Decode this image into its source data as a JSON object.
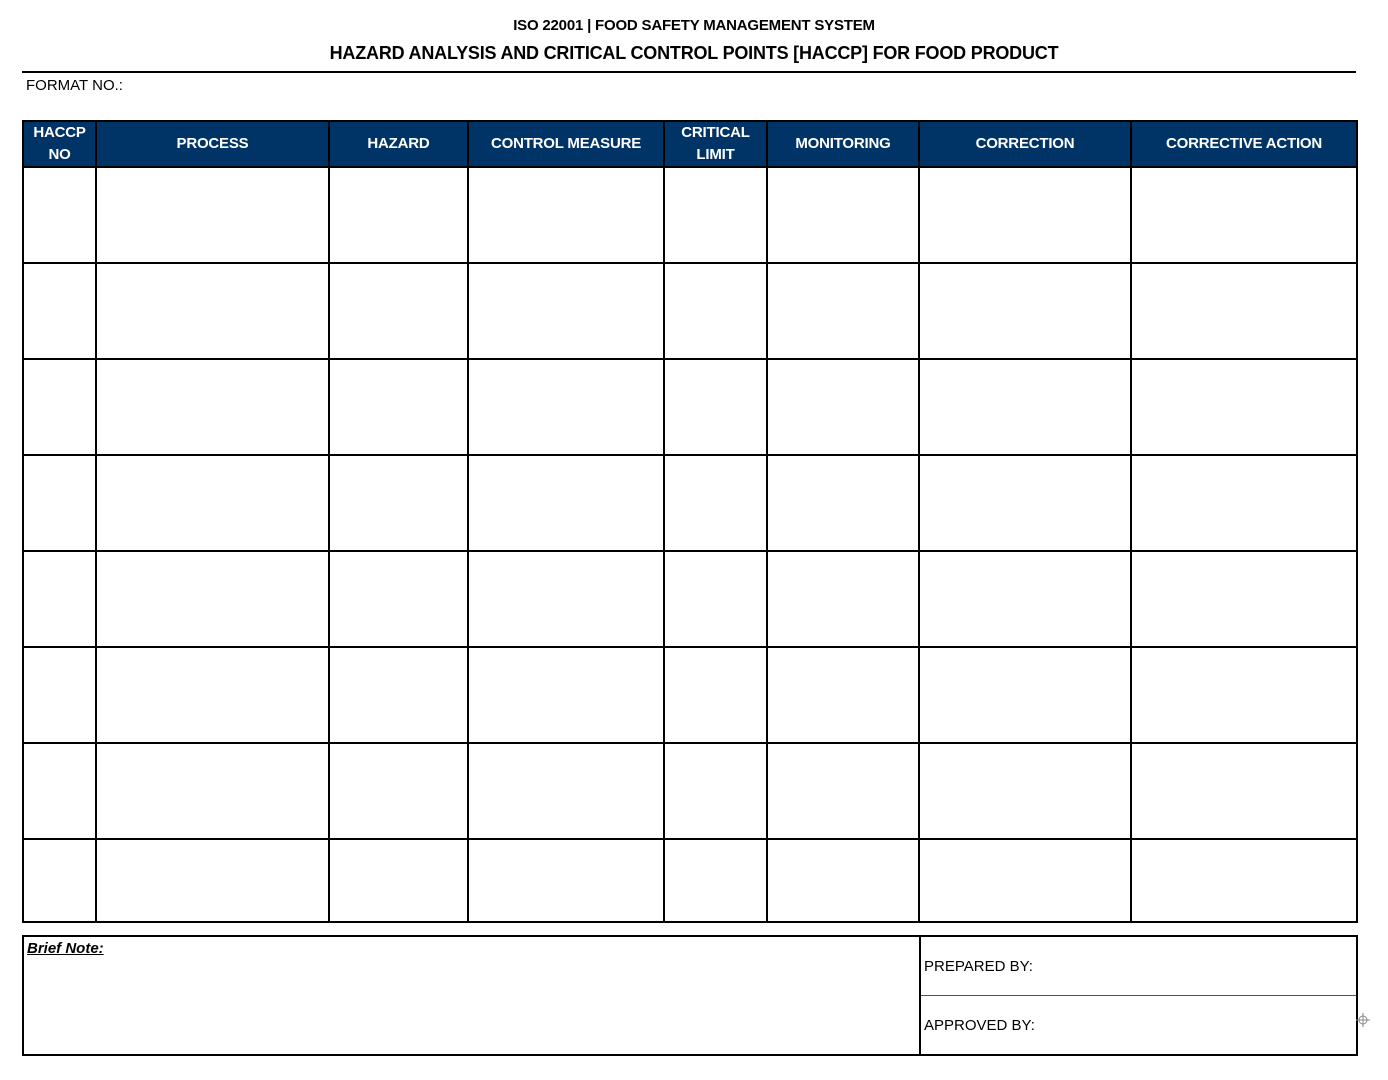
{
  "header": {
    "subtitle": "ISO 22001 | FOOD SAFETY MANAGEMENT SYSTEM",
    "title": "HAZARD ANALYSIS AND CRITICAL CONTROL POINTS [HACCP] FOR FOOD PRODUCT",
    "format_label": "FORMAT NO.:"
  },
  "table": {
    "columns": [
      {
        "line1": "HACCP",
        "line2": "NO"
      },
      {
        "line1": "PROCESS",
        "line2": ""
      },
      {
        "line1": "HAZARD",
        "line2": ""
      },
      {
        "line1": "CONTROL MEASURE",
        "line2": ""
      },
      {
        "line1": "CRITICAL",
        "line2": "LIMIT"
      },
      {
        "line1": "MONITORING",
        "line2": ""
      },
      {
        "line1": "CORRECTION",
        "line2": ""
      },
      {
        "line1": "CORRECTIVE ACTION",
        "line2": ""
      }
    ],
    "rows": [
      [
        "",
        "",
        "",
        "",
        "",
        "",
        "",
        ""
      ],
      [
        "",
        "",
        "",
        "",
        "",
        "",
        "",
        ""
      ],
      [
        "",
        "",
        "",
        "",
        "",
        "",
        "",
        ""
      ],
      [
        "",
        "",
        "",
        "",
        "",
        "",
        "",
        ""
      ],
      [
        "",
        "",
        "",
        "",
        "",
        "",
        "",
        ""
      ],
      [
        "",
        "",
        "",
        "",
        "",
        "",
        "",
        ""
      ],
      [
        "",
        "",
        "",
        "",
        "",
        "",
        "",
        ""
      ],
      [
        "",
        "",
        "",
        "",
        "",
        "",
        "",
        ""
      ]
    ],
    "header_color": "#003366"
  },
  "footer": {
    "note_label": "Brief Note:",
    "prepared_by_label": "PREPARED BY:",
    "approved_by_label": "APPROVED BY:"
  },
  "icons": {
    "table_anchor": "table-move-anchor-icon"
  }
}
